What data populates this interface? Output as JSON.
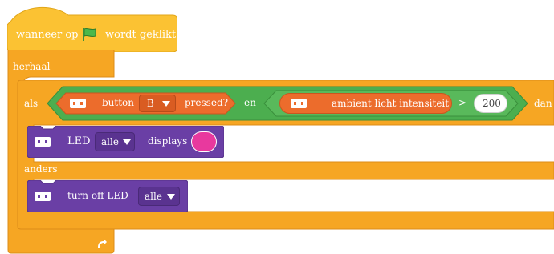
{
  "hat": {
    "prefix": "wanneer op",
    "suffix": "wordt geklikt",
    "flag_icon": "green-flag-icon"
  },
  "repeat": {
    "label": "herhaal",
    "arrow_icon": "repeat-arrow-icon"
  },
  "if_else": {
    "if_label": "als",
    "then_label": "dan",
    "else_label": "anders"
  },
  "condition": {
    "and_label": "en",
    "button_block": {
      "button_text": "button",
      "button_value": "B",
      "pressed_text": "pressed?"
    },
    "compare": {
      "light_label": "ambient licht intensiteit",
      "operator": ">",
      "value": "200"
    }
  },
  "led_block": {
    "text": "LED",
    "target": "alle",
    "displays_text": "displays",
    "color": "#e8399e"
  },
  "off_block": {
    "text": "turn off LED",
    "target": "alle"
  },
  "colors": {
    "control": "#f6a623",
    "event": "#fbc233",
    "operator": "#4cae4f",
    "sensor": "#ec6c2c",
    "display": "#6a3fa5"
  }
}
